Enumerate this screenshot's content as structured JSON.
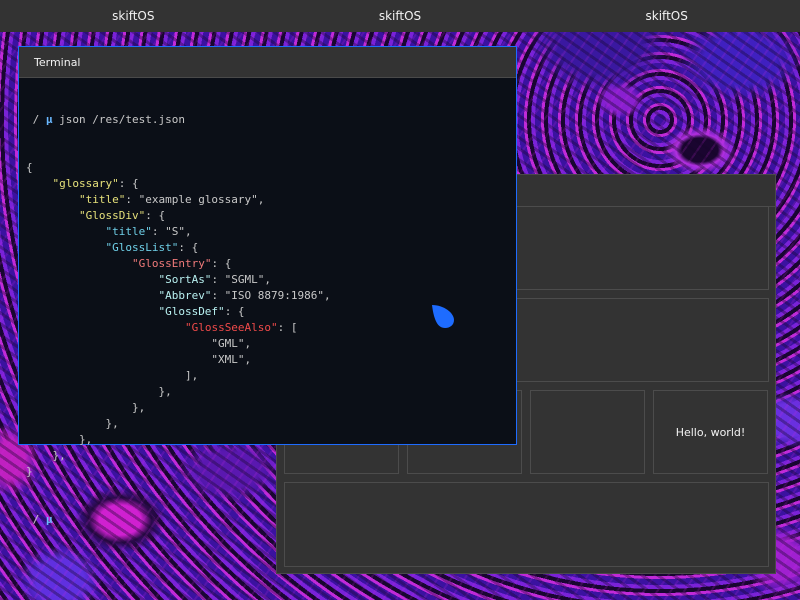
{
  "panel": {
    "items": [
      "skiftOS",
      "skiftOS",
      "skiftOS"
    ]
  },
  "terminal": {
    "title": "Terminal",
    "prompt_dir": "/",
    "prompt_symbol": "µ",
    "command": "json /res/test.json",
    "lines": [
      "{",
      "    \"glossary\": {",
      "        \"title\": \"example glossary\",",
      "        \"GlossDiv\": {",
      "            \"title\": \"S\",",
      "            \"GlossList\": {",
      "                \"GlossEntry\": {",
      "                    \"SortAs\": \"SGML\",",
      "                    \"Abbrev\": \"ISO 8879:1986\",",
      "                    \"GlossDef\": {",
      "                        \"GlossSeeAlso\": [",
      "                            \"GML\",",
      "                            \"XML\",",
      "                        ],",
      "                    },",
      "                },",
      "            },",
      "        },",
      "    },",
      "}"
    ]
  },
  "back_window": {
    "hello_label": "Hello, world!"
  },
  "colors": {
    "accent": "#1e6cff",
    "panel": "#333333",
    "terminal_bg": "#0b0f17"
  },
  "icons": {
    "cursor": "mouse-cursor-icon"
  }
}
